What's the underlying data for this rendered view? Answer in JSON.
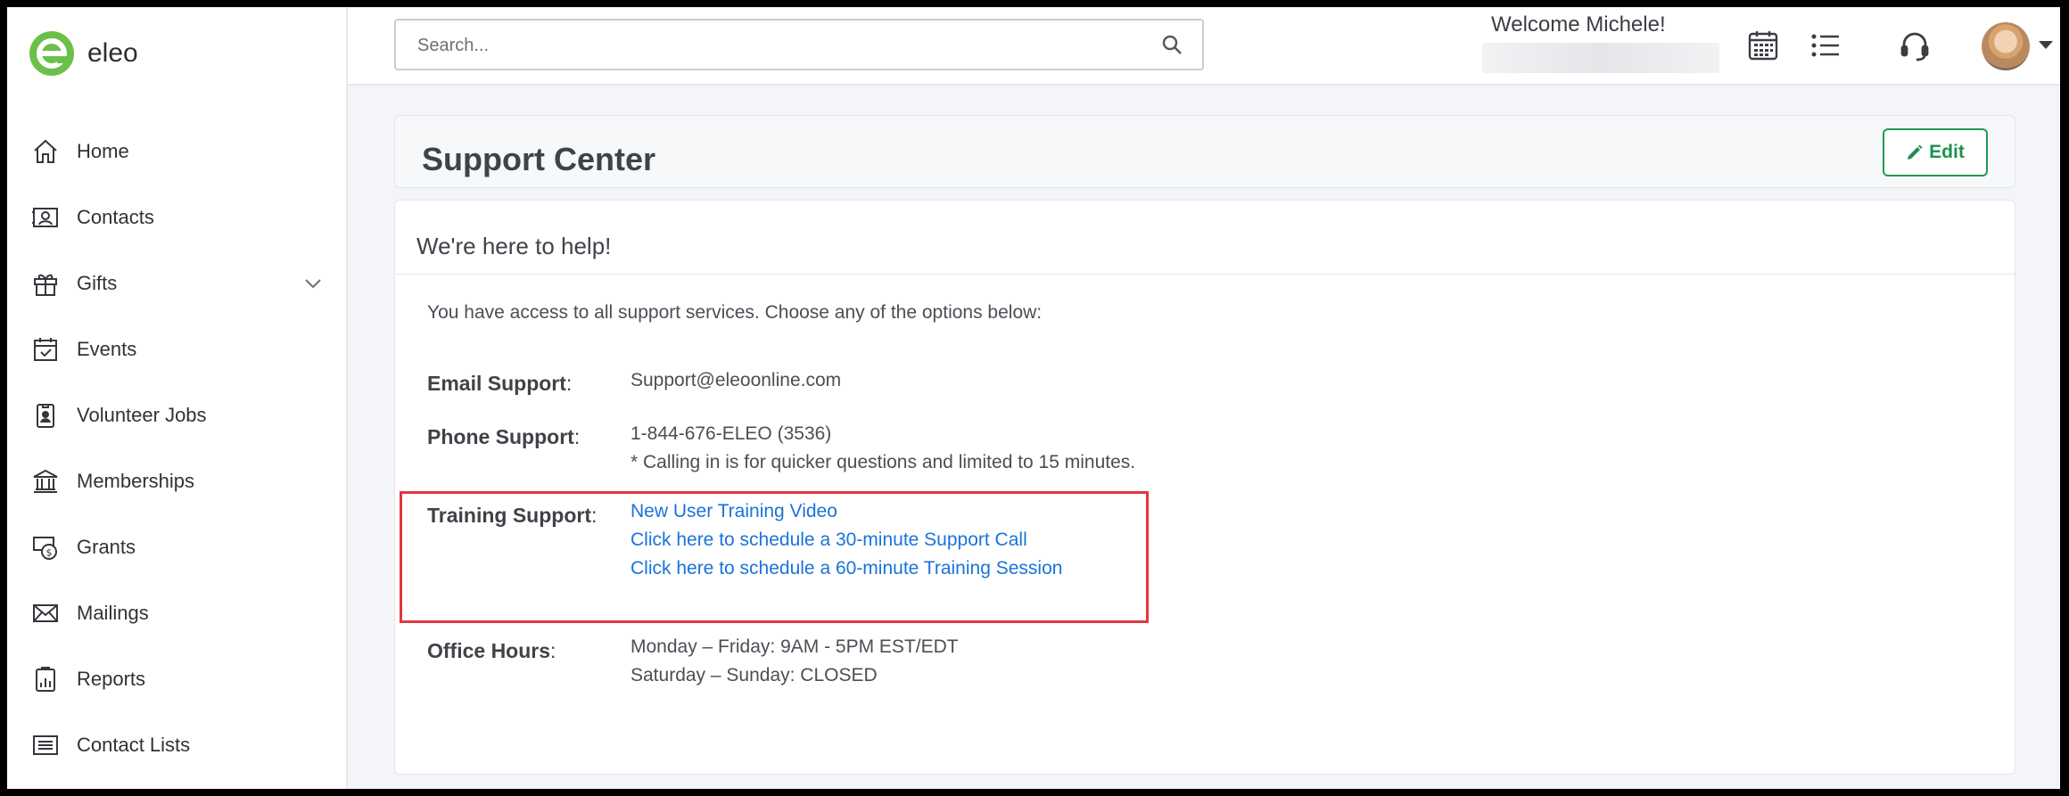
{
  "app": {
    "logo_text": "eleo"
  },
  "sidebar": {
    "items": [
      {
        "label": "Home",
        "icon": "home-icon"
      },
      {
        "label": "Contacts",
        "icon": "contact-card-icon"
      },
      {
        "label": "Gifts",
        "icon": "gift-icon"
      },
      {
        "label": "Events",
        "icon": "calendar-check-icon"
      },
      {
        "label": "Volunteer Jobs",
        "icon": "badge-icon"
      },
      {
        "label": "Memberships",
        "icon": "bank-icon"
      },
      {
        "label": "Grants",
        "icon": "money-grant-icon"
      },
      {
        "label": "Mailings",
        "icon": "envelope-icon"
      },
      {
        "label": "Reports",
        "icon": "report-icon"
      },
      {
        "label": "Contact Lists",
        "icon": "list-box-icon"
      }
    ]
  },
  "header": {
    "search_placeholder": "Search...",
    "welcome": "Welcome Michele!",
    "icons": [
      "calendar-grid-icon",
      "list-icon",
      "headset-icon"
    ]
  },
  "page": {
    "title": "Support Center",
    "edit_label": "Edit",
    "card_title": "We're here to help!",
    "intro": "You have access to all support services. Choose any of the options below:",
    "email": {
      "label": "Email Support",
      "value": "Support@eleoonline.com"
    },
    "phone": {
      "label": "Phone Support",
      "value": "1-844-676-ELEO (3536)",
      "note": "* Calling in is for quicker questions and limited to 15 minutes."
    },
    "training": {
      "label": "Training Support",
      "links": [
        "New User Training Video",
        "Click here to schedule a 30-minute Support Call",
        "Click here to schedule a 60-minute Training Session"
      ]
    },
    "hours": {
      "label": "Office Hours",
      "weekday": "Monday – Friday: 9AM - 5PM EST/EDT",
      "weekend": "Saturday – Sunday: CLOSED"
    }
  },
  "colors": {
    "brand_green": "#6cc04a",
    "link": "#1a73d9",
    "edit_green": "#1f9b55",
    "highlight_red": "#e0393e"
  }
}
